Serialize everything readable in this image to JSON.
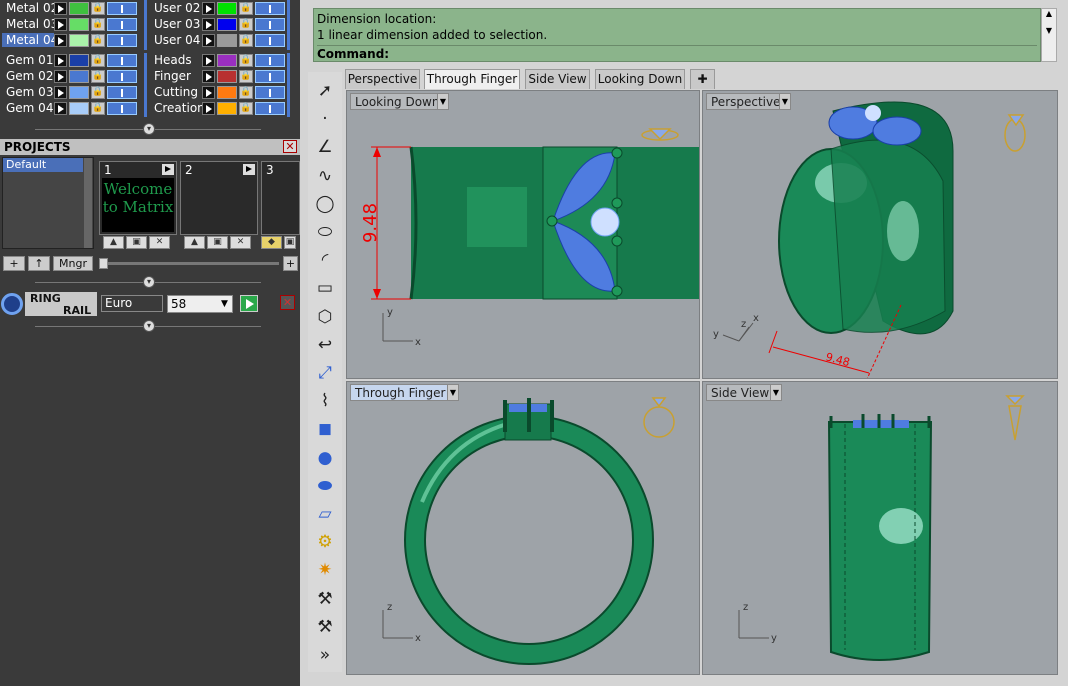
{
  "layers": {
    "left": [
      {
        "name": "Metal 02",
        "color": "#3fbf3f"
      },
      {
        "name": "Metal 03",
        "color": "#66dd66"
      },
      {
        "name": "Metal 04",
        "color": "#aaf2aa",
        "selected": true
      },
      {
        "name": "Gem 01",
        "color": "#1a3fa8"
      },
      {
        "name": "Gem 02",
        "color": "#4a78d0"
      },
      {
        "name": "Gem 03",
        "color": "#6fa2f0"
      },
      {
        "name": "Gem 04",
        "color": "#a8ccf8"
      }
    ],
    "right": [
      {
        "name": "User 02",
        "color": "#00e000"
      },
      {
        "name": "User 03",
        "color": "#0000ee"
      },
      {
        "name": "User 04",
        "color": "#9a9a9a"
      },
      {
        "name": "Heads",
        "color": "#9a2fc0"
      },
      {
        "name": "Finger",
        "color": "#b83030"
      },
      {
        "name": "Cutting",
        "color": "#ff7a10"
      },
      {
        "name": "Creation",
        "color": "#ffb000"
      }
    ]
  },
  "projects": {
    "title": "PROJECTS",
    "items": [
      "Default"
    ],
    "slots": [
      {
        "number": "1",
        "thumbnail_text": "Welcome to Matrix"
      },
      {
        "number": "2"
      },
      {
        "number": "3"
      }
    ],
    "manager_label": "Mngr"
  },
  "ring_rail": {
    "label_line1": "RING",
    "label_line2": "RAIL",
    "standard": "Euro",
    "size": "58"
  },
  "command": {
    "history": [
      "Dimension location:",
      "1 linear dimension added to selection."
    ],
    "prompt": "Command:"
  },
  "tabs": [
    "Perspective",
    "Through Finger",
    "Side View",
    "Looking Down"
  ],
  "active_tab": "Through Finger",
  "viewports": {
    "top_left": {
      "label": "Looking Down",
      "dimension": "9.48",
      "axes": [
        "y",
        "x"
      ]
    },
    "top_right": {
      "label": "Perspective",
      "dimension": "9.48",
      "axes": [
        "y",
        "z",
        "x"
      ]
    },
    "bottom_left": {
      "label": "Through Finger",
      "axes": [
        "z",
        "x"
      ]
    },
    "bottom_right": {
      "label": "Side View",
      "axes": [
        "z",
        "y"
      ]
    }
  },
  "toolbar_icons": [
    "pointer-icon",
    "point-icon",
    "polyline-icon",
    "curve-points-icon",
    "circle-icon",
    "ellipse-icon",
    "arc-icon",
    "rectangle-icon",
    "polygon-icon",
    "fillet-icon",
    "transform-icon",
    "bend-icon",
    "box-icon",
    "spheres-icon",
    "cylinder-icon",
    "surface-icon",
    "gear-icon",
    "explode-icon",
    "tools-icon",
    "tools2-icon",
    "more-icon"
  ],
  "colors": {
    "ring_green": "#1a8a58",
    "gem_blue": "#4f7ce0",
    "dimension_red": "#ee0000",
    "viewport_bg": "#9ea3a8",
    "command_bg": "#8bb48b"
  }
}
